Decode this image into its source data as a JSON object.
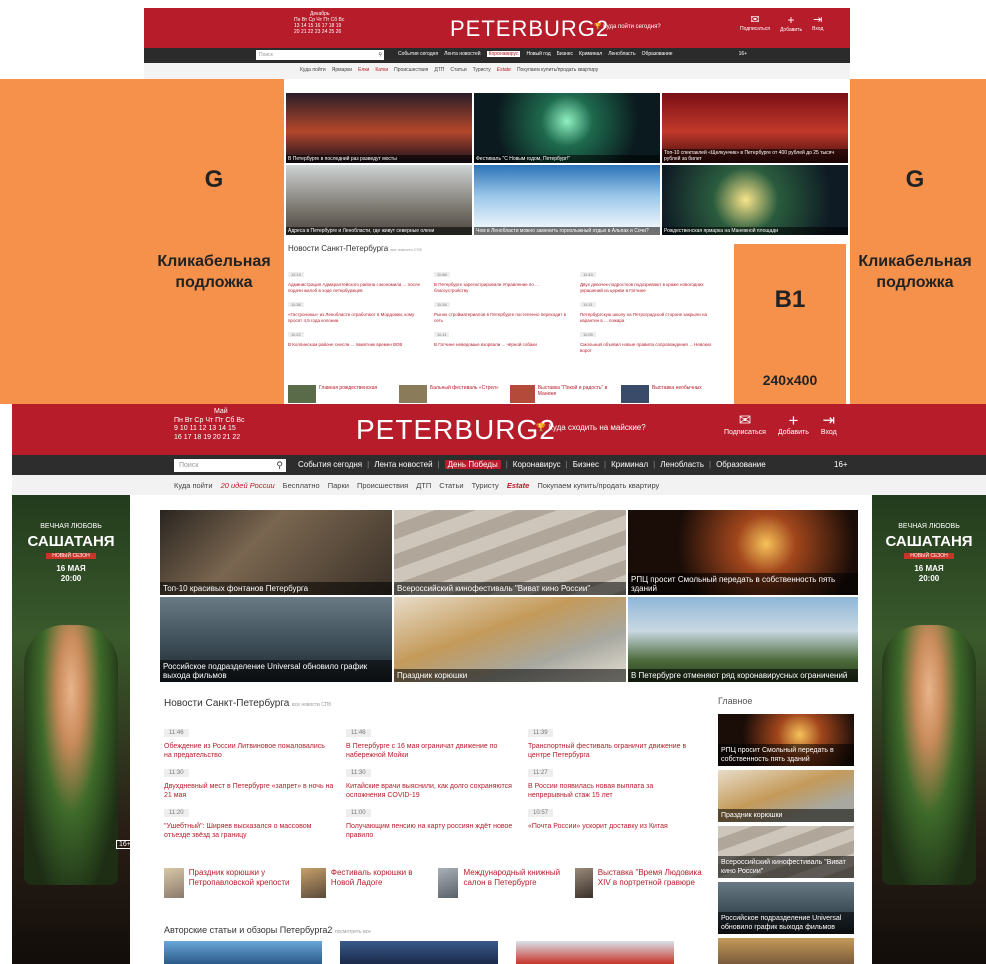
{
  "top": {
    "calendar": {
      "month": "Декабрь",
      "days": "Пн Вт Ср Чт Пт Сб Вс",
      "row1": "13 14 15 16 17 18 19",
      "row2": "20 21 22 23 24 25 26"
    },
    "logo": "PETERBURG2",
    "question": "Куда пойти сегодня?",
    "header_actions": [
      "Подписаться",
      "Добавить",
      "Вход"
    ],
    "search_placeholder": "Поиск",
    "nav": [
      "События сегодня",
      "Лента новостей",
      "Коронавирус",
      "Новый год",
      "Бизнес",
      "Криминал",
      "Ленобласть",
      "Образование",
      "16+"
    ],
    "sub": [
      "Куда пойти",
      "Ярмарки",
      "Елки",
      "Катки",
      "Происшествия",
      "ДТП",
      "Статьи",
      "Туристу",
      "Estate",
      "Покупаем купить/продать квартиру"
    ],
    "tiles": [
      "В Петербурге в последний раз разведут мосты",
      "Фестиваль \"С Новым годом, Петербург!\"",
      "Топ-10 спектаклей «Щелкунчик» в Петербурге от 400 рублей до 25 тысяч рублей за билет",
      "Адреса в Петербурге и Ленобласти, где живут северные олени",
      "Чем в Ленобласти можно заменить горнолыжный отдых в Альпах и Сочи?",
      "Рождественская ярмарка на Манежной площади"
    ],
    "news_title": "Новости Санкт-Петербурга",
    "news_all": "все новости СПб",
    "news": [
      {
        "time": "12:10",
        "text": "Администрация Адмиралтейского района сэкономила ... после подачи жалоб в ходе петербуржцев"
      },
      {
        "time": "11:58",
        "text": "В Петербурге зарегистрировали Управление по ... благоустройству"
      },
      {
        "time": "11:43",
        "text": "Двух девочек-подростков подозревают в краже новогодних украшений из церкви в Гатчине"
      },
      {
        "time": "11:38",
        "text": "«Гастрономы» из Ленобласти отработают в Мордовии, кому просят 4,5 года колонии"
      },
      {
        "time": "11:34",
        "text": "Рынок стройматериалов в Петербурге постепенно переходит в сеть"
      },
      {
        "time": "11:31",
        "text": "Петербургскую школу на Петроградской стороне закрыли на карантин в ... пожара"
      },
      {
        "time": "11:22",
        "text": "В Колпинском районе снесли ... памятник времен ВОВ"
      },
      {
        "time": "11:11",
        "text": "В Гатчине неведомые взорвали ... чёрной собаки"
      },
      {
        "time": "11:05",
        "text": "Смольный объявил новые правила сопровождения ... Невских ворот"
      }
    ],
    "cards": [
      "Главная рождественская",
      "Бальный фестиваль «Стрел»",
      "Выставка \"Покой и радость\" в Манеже",
      "Выставка необычных"
    ],
    "ad_letter": "G",
    "ad_note": "Кликабельная подложка",
    "b1_label": "B1",
    "b1_size": "240x400"
  },
  "bottom": {
    "calendar": {
      "month": "Май",
      "days": "Пн Вт Ср Чт Пт Сб Вс",
      "row1": "9 10 11 12 13 14 15",
      "row2": "16 17 18 19 20 21 22",
      "today": "12"
    },
    "logo": "PETERBURG2",
    "question": "Куда сходить на майские?",
    "header_actions": [
      "Подписаться",
      "Добавить",
      "Вход"
    ],
    "search_placeholder": "Поиск",
    "nav": [
      "События сегодня",
      "Лента новостей",
      "День Победы",
      "Коронавирус",
      "Бизнес",
      "Криминал",
      "Ленобласть",
      "Образование",
      "16+"
    ],
    "sub": [
      "Куда пойти",
      "20 идей России",
      "Бесплатно",
      "Парки",
      "Происшествия",
      "ДТП",
      "Статьи",
      "Туристу",
      "Estate",
      "Покупаем купить/продать квартиру"
    ],
    "tiles": [
      "Топ-10 красивых фонтанов Петербурга",
      "Всероссийский кинофестиваль \"Виват кино России\"",
      "РПЦ просит Смольный передать в собственность пять зданий",
      "Российское подразделение Universal обновило график выхода фильмов",
      "Праздник корюшки",
      "В Петербурге отменяют ряд коронавирусных ограничений"
    ],
    "news_title": "Новости Санкт-Петербурга",
    "news_all": "все новости СПб",
    "news": [
      {
        "time": "11:46",
        "text": "Обеждение из России Литвиновое пожаловались на предательство"
      },
      {
        "time": "11:46",
        "text": "В Петербурге с 16 мая ограничат движение по набережной Мойки"
      },
      {
        "time": "11:39",
        "text": "Транспортный фестиваль ограничит движение в центре Петербурга"
      },
      {
        "time": "11:30",
        "text": "Двухдневный мест в Петербурге «запрет» в ночь на 21 мая"
      },
      {
        "time": "11:30",
        "text": "Китайские врачи выяснили, как долго сохраняются осложнения COVID-19"
      },
      {
        "time": "11:27",
        "text": "В России появилась новая выплата за непрерывный стаж 15 лет"
      },
      {
        "time": "11:20",
        "text": "\"Ушебтный\": Ширяев высказался о массовом отъезде звёзд за границу"
      },
      {
        "time": "11:00",
        "text": "Получающим пенсию на карту россиян ждёт новое правило"
      },
      {
        "time": "10:57",
        "text": "«Почта России» ускорит доставку из Китая"
      }
    ],
    "cards": [
      "Праздник корюшки у Петропавловской крепости",
      "Фестиваль корюшки в Новой Ладоге",
      "Международный книжный салон в Петербурге",
      "Выставка \"Время Людовика XIV в портретной гравюре"
    ],
    "main_title": "Главное",
    "main_items": [
      "РПЦ просит Смольный передать в собственность пять зданий",
      "Праздник корюшки",
      "Всероссийский кинофестиваль \"Виват кино России\"",
      "Российское подразделение Universal обновило график выхода фильмов"
    ],
    "authors_title": "Авторские статьи и обзоры Петербурга2",
    "authors_all": "посмотреть все",
    "ad": {
      "title": "САШАТАНЯ",
      "over": "ВЕЧНАЯ ЛЮБОВЬ",
      "season": "НОВЫЙ СЕЗОН",
      "date": "16 МАЯ",
      "time": "20:00",
      "age": "16+"
    }
  },
  "colors": {
    "brand": "#b71c2b",
    "nav": "#2d2d2d",
    "ad_zone": "#f5914b"
  }
}
